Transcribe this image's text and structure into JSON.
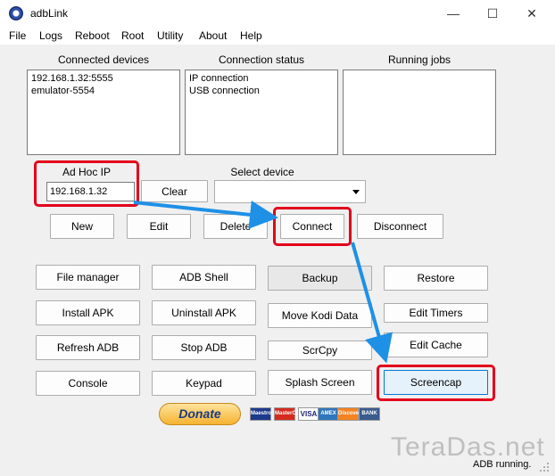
{
  "window": {
    "title": "adbLink",
    "minimize_icon": "minimize-icon",
    "maximize_icon": "maximize-icon",
    "close_icon": "close-icon"
  },
  "menu": [
    "File",
    "Logs",
    "Reboot",
    "Root",
    "Utility",
    "About",
    "Help"
  ],
  "panels": {
    "connected_devices": {
      "label": "Connected devices",
      "items": [
        "192.168.1.32:5555",
        "emulator-5554"
      ]
    },
    "connection_status": {
      "label": "Connection status",
      "items": [
        "IP connection",
        "USB connection"
      ]
    },
    "running_jobs": {
      "label": "Running jobs",
      "items": []
    }
  },
  "adhoc": {
    "label": "Ad Hoc IP",
    "value": "192.168.1.32",
    "clear_label": "Clear"
  },
  "select_device": {
    "label": "Select device",
    "value": ""
  },
  "row_buttons": {
    "new": "New",
    "edit": "Edit",
    "delete": "Delete",
    "connect": "Connect",
    "disconnect": "Disconnect"
  },
  "grid_buttons": {
    "file_manager": "File manager",
    "adb_shell": "ADB Shell",
    "backup": "Backup",
    "restore": "Restore",
    "install_apk": "Install APK",
    "uninstall_apk": "Uninstall APK",
    "move_kodi_data": "Move Kodi Data",
    "edit_timers": "Edit Timers",
    "refresh_adb": "Refresh ADB",
    "stop_adb": "Stop ADB",
    "scrcpy": "ScrCpy",
    "edit_cache": "Edit Cache",
    "console": "Console",
    "keypad": "Keypad",
    "splash_screen": "Splash Screen",
    "screencap": "Screencap"
  },
  "donate": {
    "label": "Donate"
  },
  "cards": [
    "Maestro",
    "MasterCard",
    "VISA",
    "AMEX",
    "Discover",
    "BANK"
  ],
  "watermark": "TeraDas.net",
  "status": "ADB running.",
  "colors": {
    "highlight": "#e3001b",
    "arrow": "#1e90e6",
    "selected_border": "#0078d7"
  }
}
